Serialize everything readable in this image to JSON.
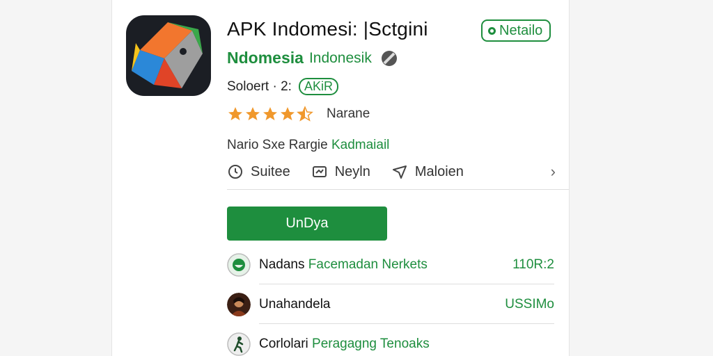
{
  "app": {
    "title": "APK Indomesi: |Sctgini",
    "detail_badge": "Netailo",
    "developer": "Ndomesia",
    "developer_sub": "Indonesik",
    "meta_text": "Soloert · 2:",
    "meta_pill": "AKiR",
    "rating_stars": 4.5,
    "rating_label": "Narane",
    "info_prefix": "Nario Sxe Rargie",
    "info_accent": "Kadmaiail"
  },
  "actions": [
    {
      "label": "Suitee",
      "icon": "clock-icon"
    },
    {
      "label": "Neyln",
      "icon": "message-icon"
    },
    {
      "label": "Maloien",
      "icon": "send-icon"
    }
  ],
  "download_label": "UnDya",
  "list": [
    {
      "title": "Nadans",
      "accent": "Facemadan Nerkets",
      "value": "110R:2",
      "icon": "shield-icon"
    },
    {
      "title": "Unahandela",
      "accent": "",
      "value": "USSIMo",
      "icon": "avatar"
    },
    {
      "title": "Corlolari",
      "accent": "Peragagng Tenoaks",
      "value": "",
      "icon": "runner-icon"
    }
  ],
  "colors": {
    "accent": "#1e8e3e",
    "star": "#f0982c"
  }
}
